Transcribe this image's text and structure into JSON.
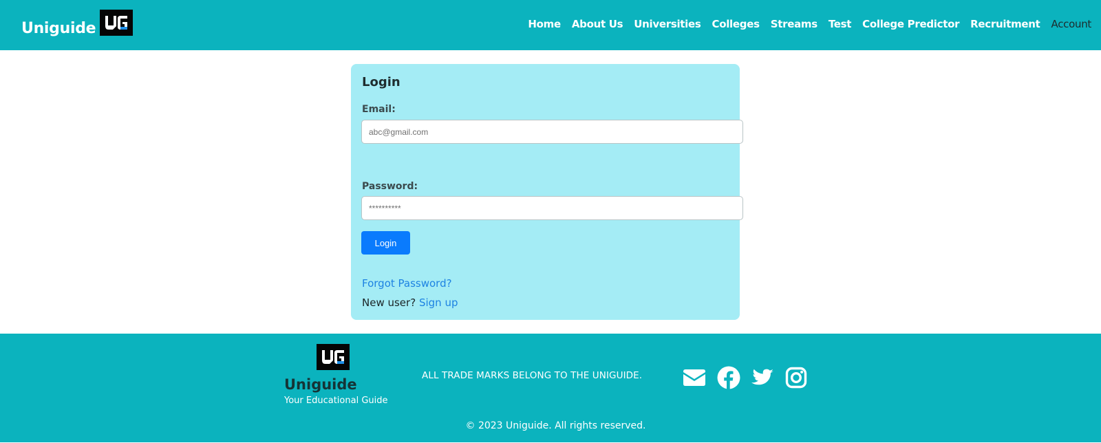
{
  "header": {
    "brand": "Uniguide",
    "nav": [
      "Home",
      "About Us",
      "Universities",
      "Colleges",
      "Streams",
      "Test",
      "College Predictor",
      "Recruitment"
    ],
    "account": "Account"
  },
  "login": {
    "title": "Login",
    "email_label": "Email:",
    "email_placeholder": "abc@gmail.com",
    "password_label": "Password:",
    "password_placeholder": "**********",
    "button": "Login",
    "forgot": "Forgot Password?",
    "new_user": "New user?",
    "signup": "Sign up"
  },
  "footer": {
    "brand": "Uniguide",
    "tagline": "Your Educational Guide",
    "trademark": "ALL TRADE MARKS BELONG TO THE UNIGUIDE.",
    "copyright": "© 2023 Uniguide. All rights reserved.",
    "social_icons": [
      "mail-icon",
      "facebook-icon",
      "twitter-icon",
      "instagram-icon"
    ]
  },
  "colors": {
    "header_bg": "#0bb3be",
    "card_bg": "#a4ecf5",
    "button_bg": "#0a7bfd",
    "link": "#1d82e2"
  }
}
